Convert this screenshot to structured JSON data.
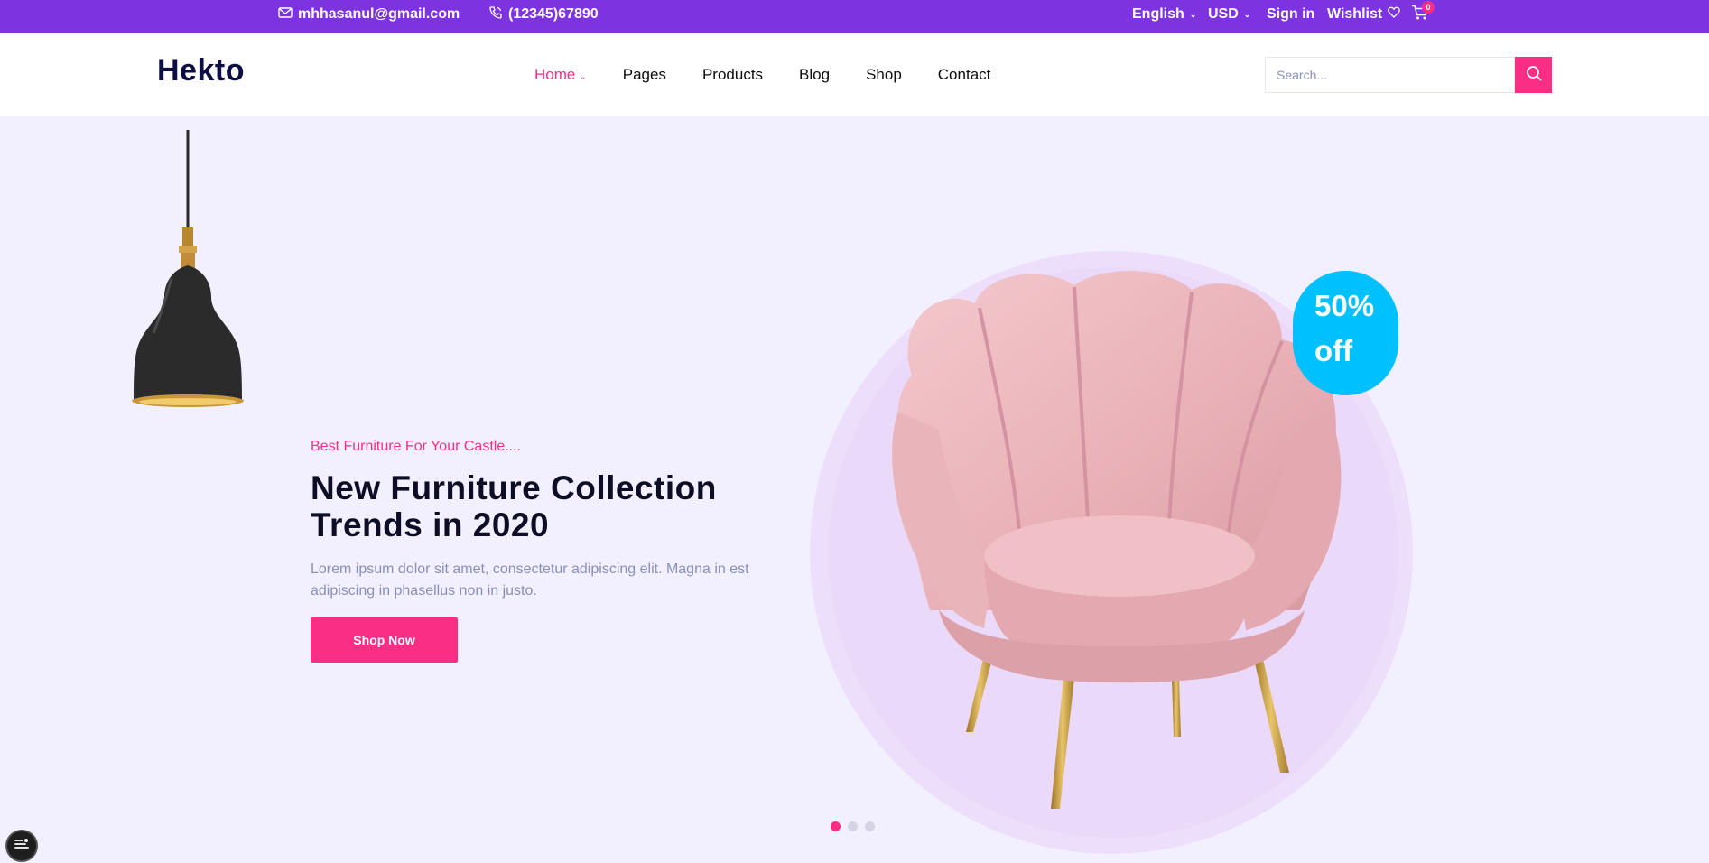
{
  "topbar": {
    "email": "mhhasanul@gmail.com",
    "phone": "(12345)67890",
    "language": "English",
    "currency": "USD",
    "signin": "Sign in",
    "wishlist": "Wishlist",
    "cart_count": "0",
    "icons": [
      "mail-icon",
      "phone-icon",
      "heart-icon",
      "cart-icon"
    ]
  },
  "header": {
    "logo": "Hekto",
    "nav": [
      {
        "label": "Home"
      },
      {
        "label": "Pages"
      },
      {
        "label": "Products"
      },
      {
        "label": "Blog"
      },
      {
        "label": "Shop"
      },
      {
        "label": "Contact"
      }
    ],
    "search_placeholder": "Search..."
  },
  "hero": {
    "subtitle": "Best Furniture For Your Castle....",
    "title": "New Furniture Collection Trends in 2020",
    "description": "Lorem ipsum dolor sit amet, consectetur adipiscing elit. Magna in est adipiscing in phasellus non in justo.",
    "button": "Shop Now",
    "badge_line1": "50%",
    "badge_line2": "off",
    "slides": 3,
    "active_slide": 1
  },
  "colors": {
    "topbar": "#7e33e0",
    "accent": "#fb2e86",
    "hero_bg": "#f2f0ff",
    "badge": "#00c1fe",
    "heading": "#0d0d25"
  }
}
